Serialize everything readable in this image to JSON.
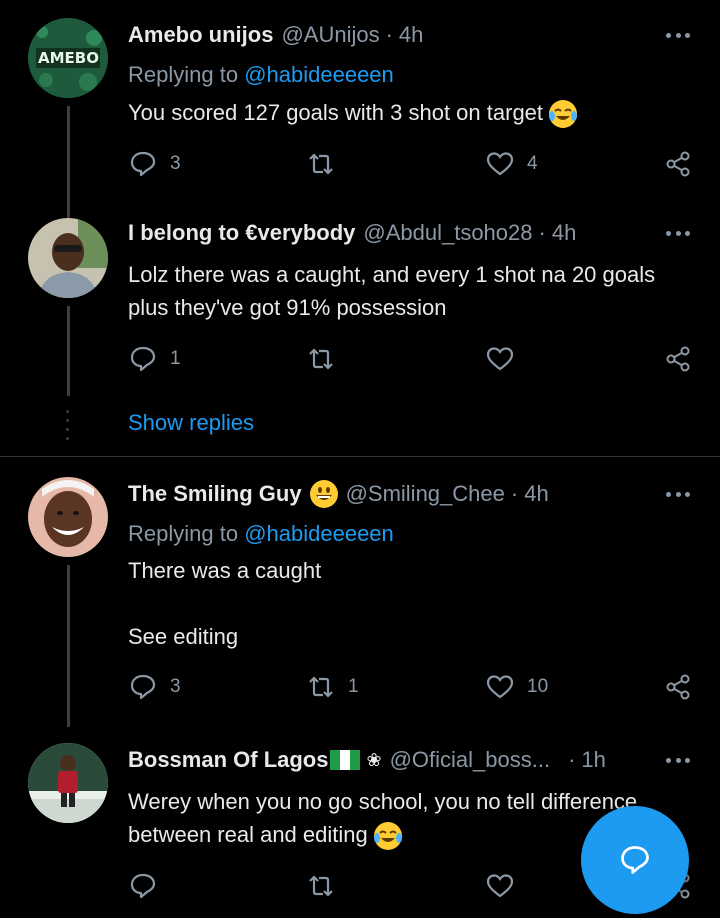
{
  "tweets": [
    {
      "name": "Amebo unijos",
      "handle": "@AUnijos",
      "time": "4h",
      "replying_label": "Replying to",
      "replying_handle": "@habideeeeen",
      "text": "You scored 127 goals with 3 shot on target",
      "emoji": "face-with-tears-of-joy",
      "replies": "3",
      "retweets": "",
      "likes": "4",
      "avatar_text": "AMEBO"
    },
    {
      "name": "I belong to €verybody",
      "handle": "@Abdul_tsoho28",
      "time": "4h",
      "text": "Lolz there was a caught, and every 1 shot na 20 goals plus they've got 91% possession",
      "replies": "1",
      "retweets": "",
      "likes": ""
    },
    {
      "name": "The Smiling Guy",
      "name_emoji": "grinning-face",
      "handle": "@Smiling_Chee",
      "time": "4h",
      "replying_label": "Replying to",
      "replying_handle": "@habideeeeen",
      "text_line1": "There was a caught",
      "text_line2": "See editing",
      "replies": "3",
      "retweets": "1",
      "likes": "10"
    },
    {
      "name": "Bossman Of Lagos",
      "name_extras": "nigeria-flag, flower-glyph",
      "handle": "@Oficial_boss...",
      "time": "1h",
      "text": "Werey when you no go school, you no tell difference between real and editing",
      "emoji": "face-with-tears-of-joy",
      "replies": "",
      "retweets": "",
      "likes": ""
    }
  ],
  "show_replies": "Show replies",
  "time_sep": "·",
  "colors": {
    "background": "#000000",
    "accent": "#1d9bf0",
    "muted": "#8b98a5"
  },
  "fab": {
    "icon": "compose-reply-icon"
  }
}
